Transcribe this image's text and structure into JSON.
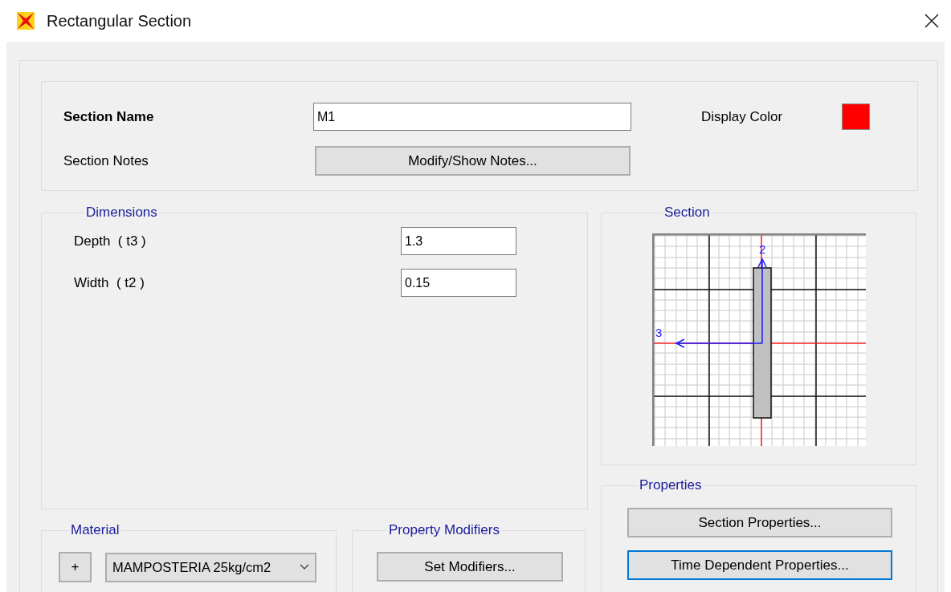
{
  "window": {
    "title": "Rectangular Section"
  },
  "section_name": {
    "label": "Section Name",
    "value": "M1"
  },
  "display_color": {
    "label": "Display Color",
    "color": "#ff0000"
  },
  "section_notes": {
    "label": "Section Notes",
    "button": "Modify/Show Notes..."
  },
  "dimensions": {
    "title": "Dimensions",
    "fields": [
      {
        "label": "Depth  ( t3 )",
        "value": "1.3"
      },
      {
        "label": "Width  ( t2 )",
        "value": "0.15"
      }
    ]
  },
  "section_view": {
    "title": "Section",
    "axis_2": "2",
    "axis_3": "3"
  },
  "properties": {
    "title": "Properties",
    "buttons": [
      {
        "label": "Section Properties...",
        "focused": false
      },
      {
        "label": "Time Dependent Properties...",
        "focused": true
      }
    ]
  },
  "material": {
    "title": "Material",
    "add_button": "+",
    "value": "MAMPOSTERIA 25kg/cm2"
  },
  "property_modifiers": {
    "title": "Property Modifiers",
    "button": "Set Modifiers..."
  }
}
